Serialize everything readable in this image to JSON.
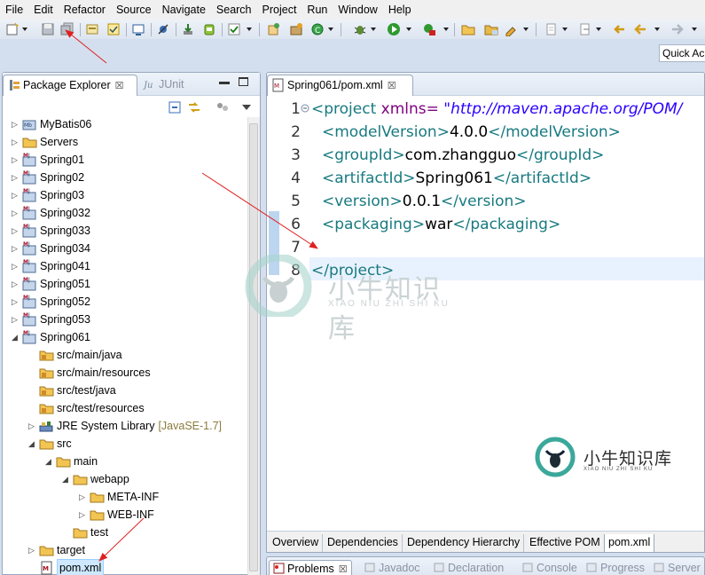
{
  "menu": [
    "File",
    "Edit",
    "Refactor",
    "Source",
    "Navigate",
    "Search",
    "Project",
    "Run",
    "Window",
    "Help"
  ],
  "quick_access": "Quick Ac",
  "left_view": {
    "tabs": [
      {
        "label": "Package Explorer",
        "close": "☒"
      },
      {
        "label": "JUnit"
      }
    ],
    "tree": [
      {
        "label": "MyBatis06",
        "icon": "project-icon",
        "state": "collapsed"
      },
      {
        "label": "Servers",
        "icon": "folder-icon",
        "state": "collapsed"
      },
      {
        "label": "Spring01",
        "icon": "maven-project-icon",
        "state": "collapsed"
      },
      {
        "label": "Spring02",
        "icon": "maven-project-icon",
        "state": "collapsed"
      },
      {
        "label": "Spring03",
        "icon": "maven-project-icon",
        "state": "collapsed"
      },
      {
        "label": "Spring032",
        "icon": "maven-project-icon",
        "state": "collapsed"
      },
      {
        "label": "Spring033",
        "icon": "maven-project-icon",
        "state": "collapsed"
      },
      {
        "label": "Spring034",
        "icon": "maven-project-icon",
        "state": "collapsed"
      },
      {
        "label": "Spring041",
        "icon": "maven-project-icon",
        "state": "collapsed"
      },
      {
        "label": "Spring051",
        "icon": "maven-project-icon",
        "state": "collapsed"
      },
      {
        "label": "Spring052",
        "icon": "maven-project-icon",
        "state": "collapsed"
      },
      {
        "label": "Spring053",
        "icon": "maven-project-icon",
        "state": "collapsed"
      },
      {
        "label": "Spring061",
        "icon": "maven-project-icon",
        "state": "expanded"
      },
      {
        "label": "src/main/java",
        "icon": "source-folder-icon",
        "state": "none"
      },
      {
        "label": "src/main/resources",
        "icon": "source-folder-icon",
        "state": "none"
      },
      {
        "label": "src/test/java",
        "icon": "source-folder-icon",
        "state": "none"
      },
      {
        "label": "src/test/resources",
        "icon": "source-folder-icon",
        "state": "none"
      },
      {
        "label": "JRE System Library",
        "decoration": "[JavaSE-1.7]",
        "icon": "library-icon",
        "state": "collapsed"
      },
      {
        "label": "src",
        "icon": "folder-icon",
        "state": "expanded"
      },
      {
        "label": "main",
        "icon": "folder-icon",
        "state": "expanded"
      },
      {
        "label": "webapp",
        "icon": "folder-icon",
        "state": "expanded"
      },
      {
        "label": "META-INF",
        "icon": "folder-icon",
        "state": "collapsed"
      },
      {
        "label": "WEB-INF",
        "icon": "folder-icon",
        "state": "collapsed"
      },
      {
        "label": "test",
        "icon": "folder-icon",
        "state": "none"
      },
      {
        "label": "target",
        "icon": "folder-icon",
        "state": "collapsed"
      },
      {
        "label": "pom.xml",
        "icon": "xml-file-icon",
        "state": "none",
        "selected": true
      }
    ]
  },
  "editor": {
    "tab_label": "Spring061/pom.xml",
    "tab_close": "☒",
    "line_numbers": [
      "1",
      "2",
      "3",
      "4",
      "5",
      "6",
      "7",
      "8"
    ],
    "lines": {
      "l1": {
        "open": "<project",
        "attr": " xmlns=",
        "value": " \"http://maven.apache.org/POM/"
      },
      "l2": {
        "open": "<modelVersion>",
        "text": "4.0.0",
        "close": "</modelVersion>"
      },
      "l3": {
        "open": "<groupId>",
        "text": "com.zhangguo",
        "close": "</groupId>"
      },
      "l4": {
        "open": "<artifactId>",
        "text": "Spring061",
        "close": "</artifactId>"
      },
      "l5": {
        "open": "<version>",
        "text": "0.0.1",
        "close": "</version>"
      },
      "l6": {
        "open": "<packaging>",
        "text": "war",
        "close": "</packaging>"
      },
      "l8": {
        "close": "</project>"
      }
    },
    "bottom_tabs": [
      "Overview",
      "Dependencies",
      "Dependency Hierarchy",
      "Effective POM",
      "pom.xml"
    ],
    "active_bottom_tab": "pom.xml"
  },
  "bottom_panel": {
    "tabs": [
      "Problems",
      "Javadoc",
      "Declaration",
      "Console",
      "Progress",
      "Server"
    ]
  },
  "watermark": {
    "large_text": "小牛知识库",
    "large_sub": "XIAO NIU ZHI SHI KU",
    "small_text": "小牛知识库",
    "small_sub": "XIAO NIU ZHI SHI KU"
  },
  "colors": {
    "arrow": "#e02020",
    "xml_tag": "#187a80",
    "xml_attr": "#7f007f",
    "xml_string": "#2a00ff",
    "selection": "#cde8ff",
    "current_line": "#e8f2fe",
    "watermark_teal": "#3aa89a"
  }
}
